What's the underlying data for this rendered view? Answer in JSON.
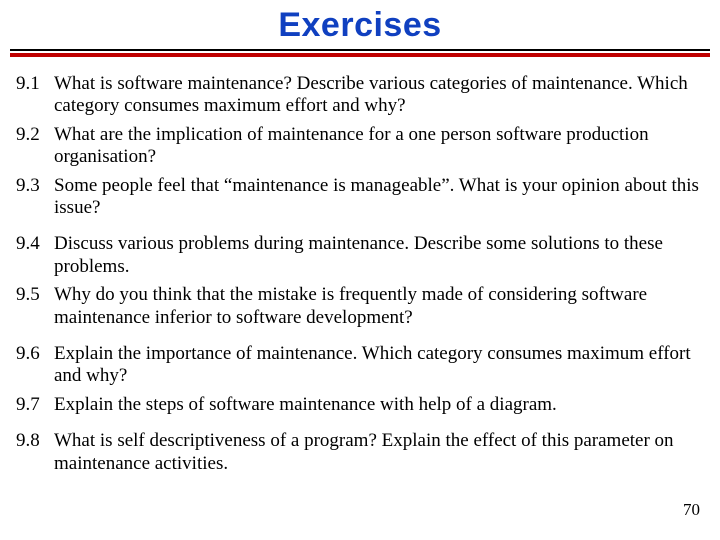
{
  "title": "Exercises",
  "items": [
    {
      "num": "9.1",
      "text": "What is software maintenance? Describe various categories of maintenance. Which category consumes maximum effort and why?"
    },
    {
      "num": "9.2",
      "text": "What are the implication of maintenance for a one person software production organisation?"
    },
    {
      "num": "9.3",
      "text": "Some people feel that “maintenance is manageable”. What is your opinion about this issue?"
    },
    {
      "num": "9.4",
      "text": "Discuss various problems during maintenance. Describe some solutions to these problems."
    },
    {
      "num": "9.5",
      "text": "Why do you think that the mistake is frequently made of considering software maintenance inferior to software development?"
    },
    {
      "num": "9.6",
      "text": "Explain the importance of maintenance. Which category consumes maximum effort and why?"
    },
    {
      "num": "9.7",
      "text": "Explain the steps of software maintenance with help of a diagram."
    },
    {
      "num": "9.8",
      "text": "What is self descriptiveness of a program? Explain the effect of this parameter on maintenance activities."
    }
  ],
  "page_number": "70"
}
